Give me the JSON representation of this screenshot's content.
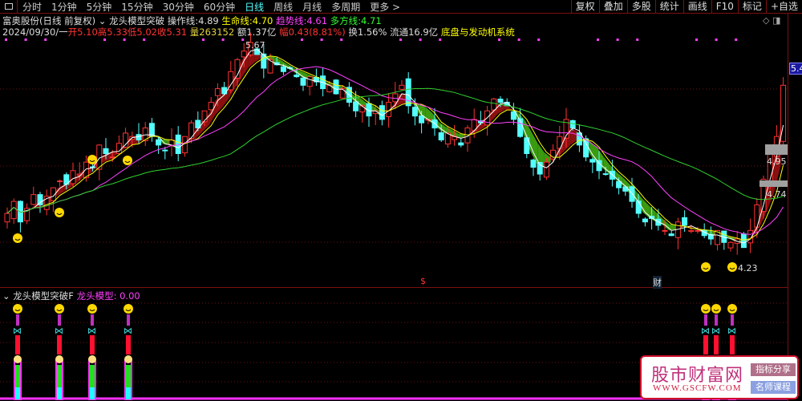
{
  "toolbar": {
    "periods": [
      "分时",
      "1分钟",
      "5分钟",
      "15分钟",
      "30分钟",
      "60分钟",
      "日线",
      "周线",
      "月线",
      "多周期",
      "更多 >"
    ],
    "active": "日线",
    "tools": [
      "复权",
      "叠加",
      "多股",
      "统计",
      "画线",
      "F10",
      "标记",
      "+自选"
    ]
  },
  "info1": {
    "stock": "富奥股份(日线 前复权)",
    "indicator": "龙头模型突破",
    "op_label": "操作线:",
    "op": "4.89",
    "life_label": "生命线:",
    "life": "4.70",
    "trend_label": "趋势线:",
    "trend": "4.61",
    "bull_label": "多方线:",
    "bull": "4.71"
  },
  "info2": {
    "date": "2024/09/30/一",
    "open_l": "开",
    "open": "5.10",
    "high_l": "高",
    "high": "5.33",
    "low_l": "低",
    "low": "5.02",
    "close_l": "收",
    "close": "5.31",
    "vol_l": "量",
    "vol": "263152",
    "amt": "额1.37亿",
    "chg_l": "幅",
    "chg": "0.43(8.81%)",
    "turn": "换1.56%",
    "float": "流通16.9亿",
    "system": "底盘与发动机系统"
  },
  "axis": {
    "price_label": "5.4"
  },
  "marks": {
    "high": "5.67",
    "low": "4.23",
    "right1": "4.95",
    "right2": "4.74",
    "dollar": "$",
    "cai": "财"
  },
  "sub": {
    "title": "龙头模型突破F",
    "value_label": "龙头模型:",
    "value": "0.00"
  },
  "watermark": {
    "title": "股市财富网",
    "url": "WWW.GSCFW.COM",
    "badge1": "指标分享",
    "badge2": "名师课程"
  },
  "colors": {
    "up": "#ff3232",
    "down": "#54ffff",
    "ma_fast": "#ffffff",
    "ma_mid": "#ffff00",
    "ma_slow": "#ff40ff",
    "ma_long": "#30d030"
  },
  "chart_data": {
    "type": "candlestick",
    "closes": [
      4.55,
      4.62,
      4.5,
      4.58,
      4.66,
      4.6,
      4.65,
      4.7,
      4.74,
      4.72,
      4.8,
      4.78,
      4.85,
      4.82,
      4.95,
      4.9,
      4.88,
      4.96,
      5.02,
      5.0,
      4.98,
      5.05,
      5.0,
      4.95,
      4.92,
      4.98,
      4.9,
      5.0,
      5.08,
      5.05,
      5.15,
      5.2,
      5.28,
      5.25,
      5.38,
      5.45,
      5.5,
      5.55,
      5.48,
      5.4,
      5.45,
      5.42,
      5.38,
      5.4,
      5.35,
      5.3,
      5.35,
      5.32,
      5.28,
      5.3,
      5.25,
      5.28,
      5.2,
      5.15,
      5.18,
      5.12,
      5.15,
      5.1,
      5.2,
      5.25,
      5.3,
      5.18,
      5.12,
      5.08,
      5.1,
      5.05,
      4.98,
      5.02,
      5.0,
      4.95,
      5.05,
      5.1,
      5.08,
      5.15,
      5.22,
      5.2,
      5.18,
      5.1,
      5.0,
      4.9,
      4.82,
      4.78,
      4.85,
      4.92,
      5.0,
      5.1,
      5.05,
      4.95,
      4.88,
      4.85,
      4.8,
      4.78,
      4.75,
      4.7,
      4.68,
      4.62,
      4.55,
      4.5,
      4.52,
      4.48,
      4.45,
      4.42,
      4.5,
      4.48,
      4.45,
      4.45,
      4.42,
      4.4,
      4.45,
      4.38,
      4.38,
      4.4,
      4.35,
      4.45,
      4.6,
      4.75,
      4.9,
      5.0,
      5.3
    ],
    "signal_bars": [
      2,
      8,
      13,
      19,
      107,
      109,
      111
    ]
  }
}
